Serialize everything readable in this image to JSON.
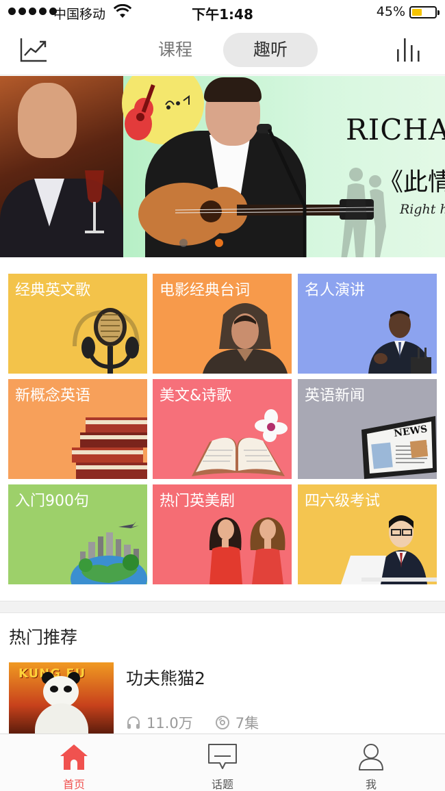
{
  "status_bar": {
    "carrier": "中国移动",
    "time": "下午1:48",
    "battery_percent": "45%",
    "battery_level": 0.45
  },
  "nav": {
    "left_icon": "trend-chart-icon",
    "right_icon": "equalizer-icon",
    "tabs": [
      {
        "label": "课程",
        "active": false
      },
      {
        "label": "趣听",
        "active": true
      }
    ]
  },
  "banner": {
    "title": "RICHAR",
    "subtitle": "《此情",
    "caption": "Right he",
    "page_count": 2,
    "active_page": 1
  },
  "categories": [
    {
      "label": "经典英文歌",
      "icon": "headphones-mic-icon",
      "color": "#f3c34a"
    },
    {
      "label": "电影经典台词",
      "icon": "movie-actor-icon",
      "color": "#f79a4b"
    },
    {
      "label": "名人演讲",
      "icon": "speaker-podium-icon",
      "color": "#8ca3ef"
    },
    {
      "label": "新概念英语",
      "icon": "books-stack-icon",
      "color": "#f7a05a"
    },
    {
      "label": "美文&诗歌",
      "icon": "open-book-flower-icon",
      "color": "#f6707a"
    },
    {
      "label": "英语新闻",
      "icon": "tablet-news-icon",
      "color": "#a8a8b4"
    },
    {
      "label": "入门900句",
      "icon": "globe-city-icon",
      "color": "#9dd06a"
    },
    {
      "label": "热门英美剧",
      "icon": "tv-actresses-icon",
      "color": "#f56d74"
    },
    {
      "label": "四六级考试",
      "icon": "student-exam-icon",
      "color": "#f4c550"
    }
  ],
  "recommend": {
    "title": "热门推荐",
    "items": [
      {
        "title": "功夫熊猫2",
        "thumb_text": "KUNG FU",
        "listens": "11.0万",
        "episodes": "7集"
      }
    ]
  },
  "tabbar": {
    "items": [
      {
        "label": "首页",
        "icon": "home-icon",
        "active": true
      },
      {
        "label": "话题",
        "icon": "chat-bubble-icon",
        "active": false
      },
      {
        "label": "我",
        "icon": "user-icon",
        "active": false
      }
    ]
  },
  "colors": {
    "accent": "#f0524f",
    "battery": "#f6c400",
    "banner_dot_active": "#e8731c"
  }
}
